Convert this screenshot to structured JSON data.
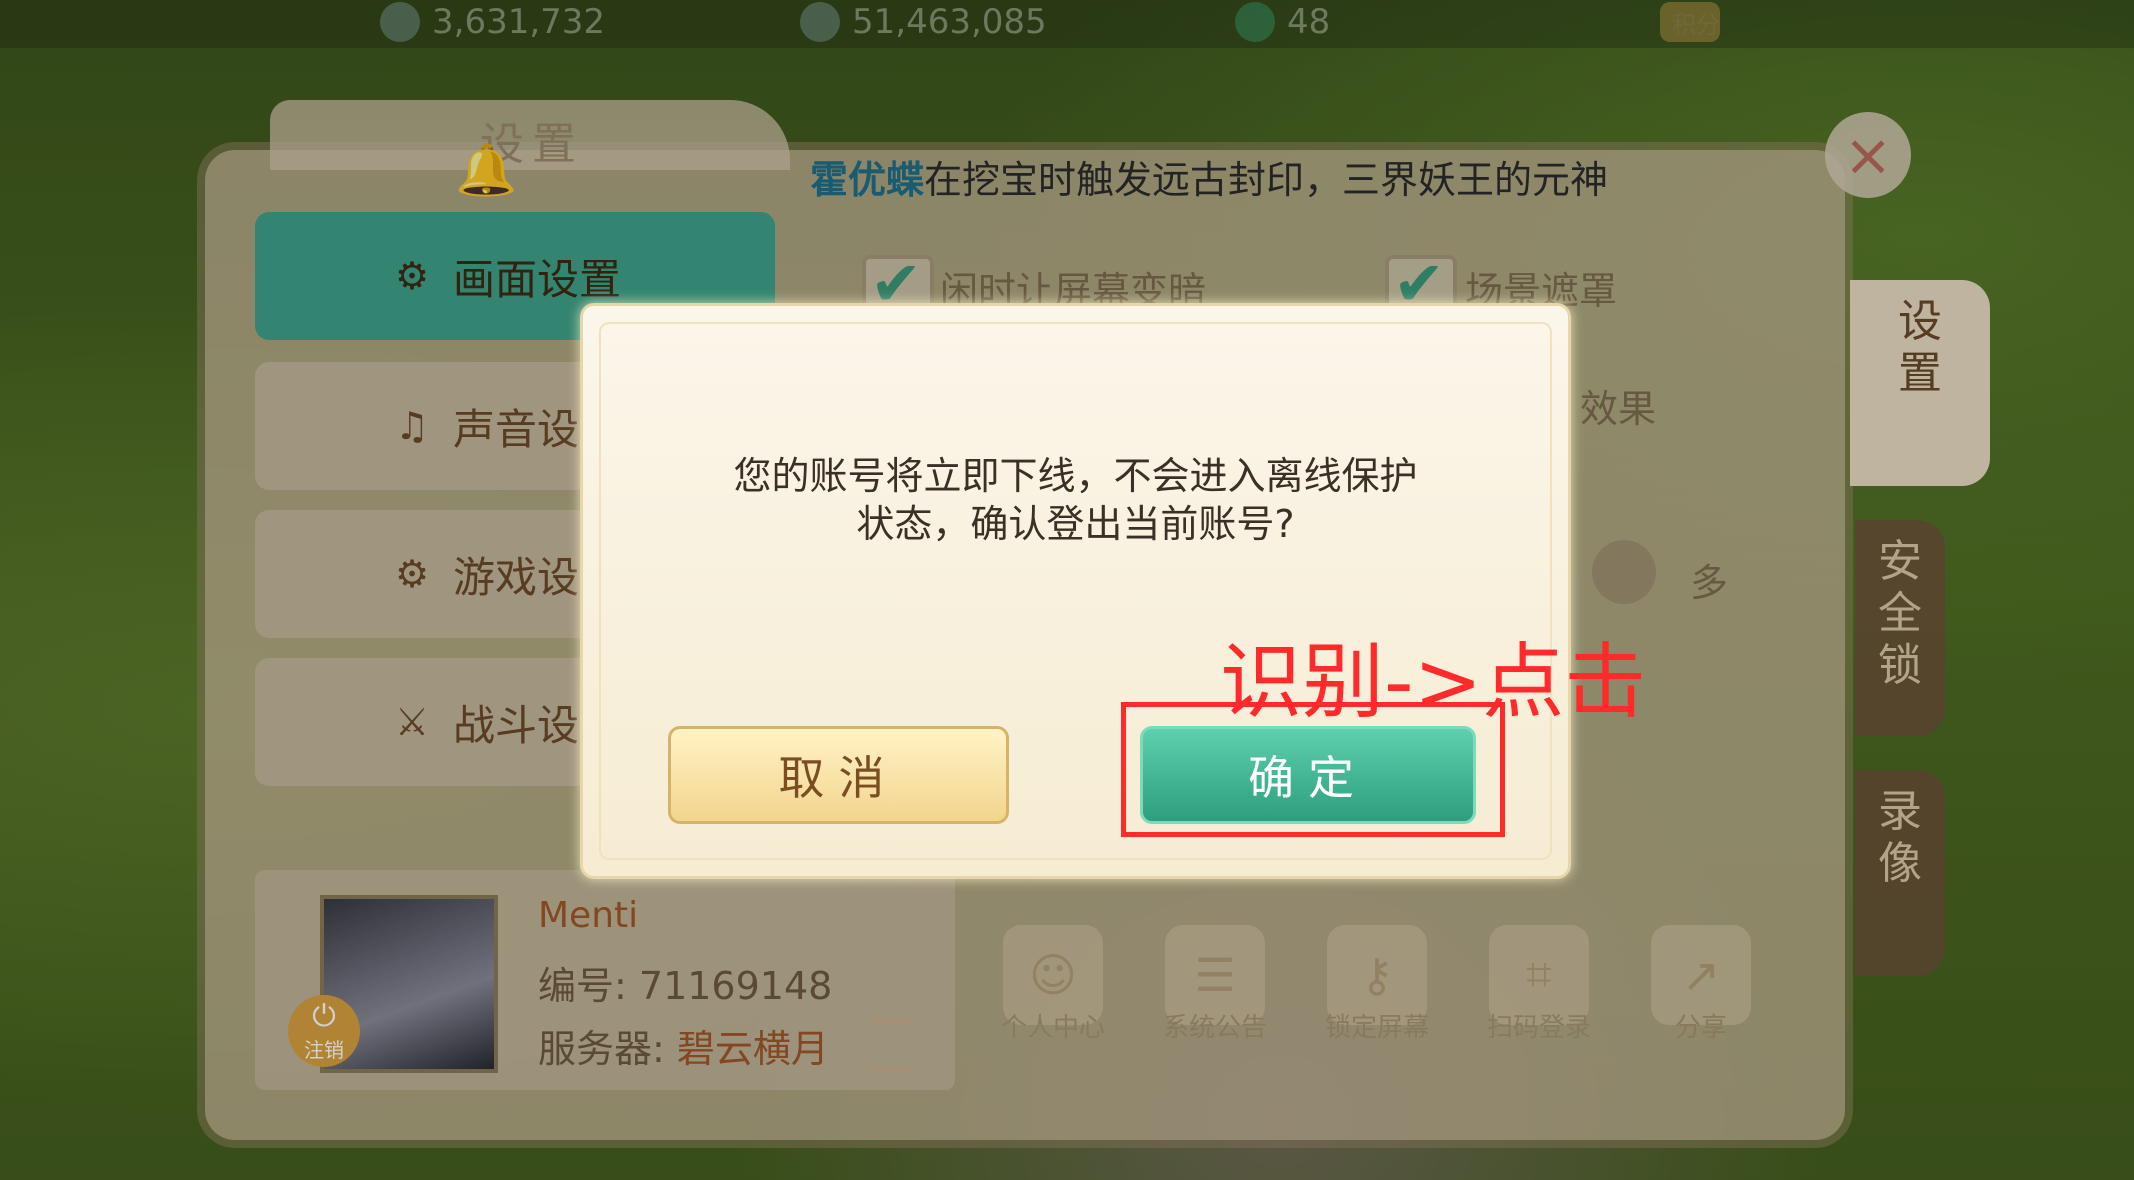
{
  "topbar": {
    "coin_value": "3,631,732",
    "silver_value": "51,463,085",
    "jade_value": "48",
    "points_label": "积分"
  },
  "settings_panel": {
    "title": "设置",
    "close_icon": "×",
    "ticker": {
      "player_name": "霍优蝶",
      "message": "在挖宝时触发远古封印，三界妖王的元神"
    },
    "side_tabs": [
      {
        "label": "画面设置",
        "icon": "monitor-icon",
        "active": true
      },
      {
        "label": "声音设",
        "icon": "music-icon",
        "active": false
      },
      {
        "label": "游戏设",
        "icon": "gear-icon",
        "active": false
      },
      {
        "label": "战斗设",
        "icon": "sword-icon",
        "active": false
      }
    ],
    "options": {
      "dim_screen": "闲时让屏幕变暗",
      "scene_mask": "场景遮罩",
      "effect_suffix": "效果",
      "more_label": "多"
    },
    "right_tabs": [
      "设\n置",
      "安\n全\n锁",
      "录\n像"
    ],
    "profile": {
      "name": "Menti",
      "id_label": "编号: ",
      "id_value": "71169148",
      "server_label": "服务器: ",
      "server_value": "碧云横月",
      "logout_label": "注销"
    },
    "actions": [
      {
        "label": "个人中心",
        "icon": "person-icon"
      },
      {
        "label": "系统公告",
        "icon": "scroll-icon"
      },
      {
        "label": "锁定屏幕",
        "icon": "key-icon"
      },
      {
        "label": "扫码登录",
        "icon": "qr-icon"
      },
      {
        "label": "分享",
        "icon": "share-icon"
      }
    ]
  },
  "dialog": {
    "message_line1": "您的账号将立即下线，不会进入离线保护",
    "message_line2": "状态，确认登出当前账号?",
    "cancel_label": "取消",
    "confirm_label": "确定"
  },
  "annotation": {
    "text": "识别->点击",
    "color": "#ff2a2a"
  }
}
